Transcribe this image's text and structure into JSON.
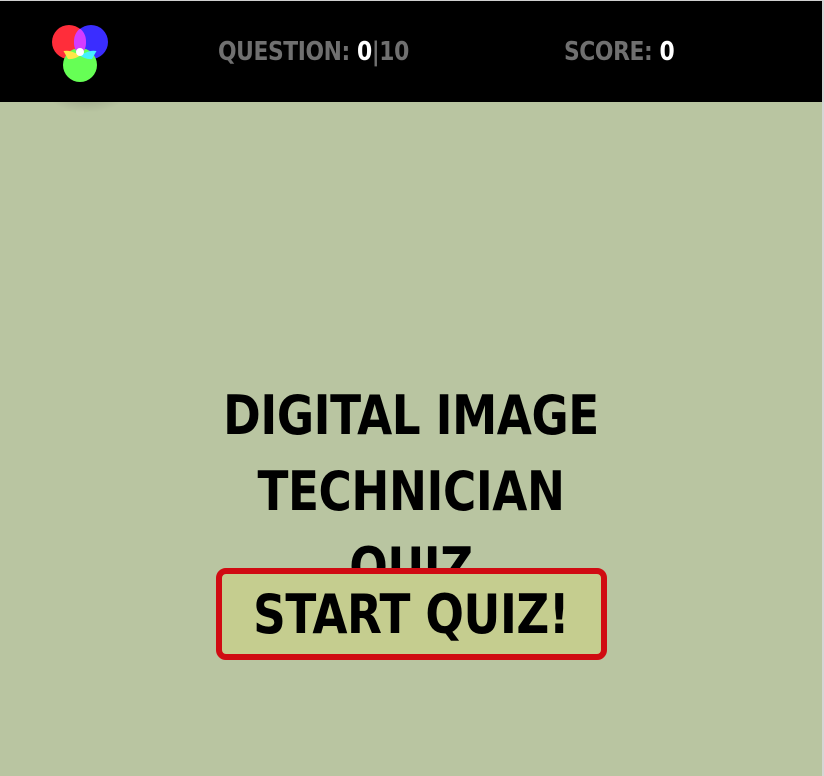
{
  "header": {
    "logo_icon": "rgb-circles-logo-icon",
    "question_label": "QUESTION:",
    "question_current": "0",
    "question_separator": "|",
    "question_total": "10",
    "score_label": "SCORE:",
    "score_value": "0"
  },
  "main": {
    "title_line1": "DIGITAL IMAGE TECHNICIAN",
    "title_line2": "QUIZ",
    "start_label": "START QUIZ!"
  },
  "colors": {
    "background": "#b9c5a1",
    "header_bg": "#000000",
    "label_gray": "#707070",
    "button_fill": "#c5cd8f",
    "button_border": "#d00b12"
  }
}
